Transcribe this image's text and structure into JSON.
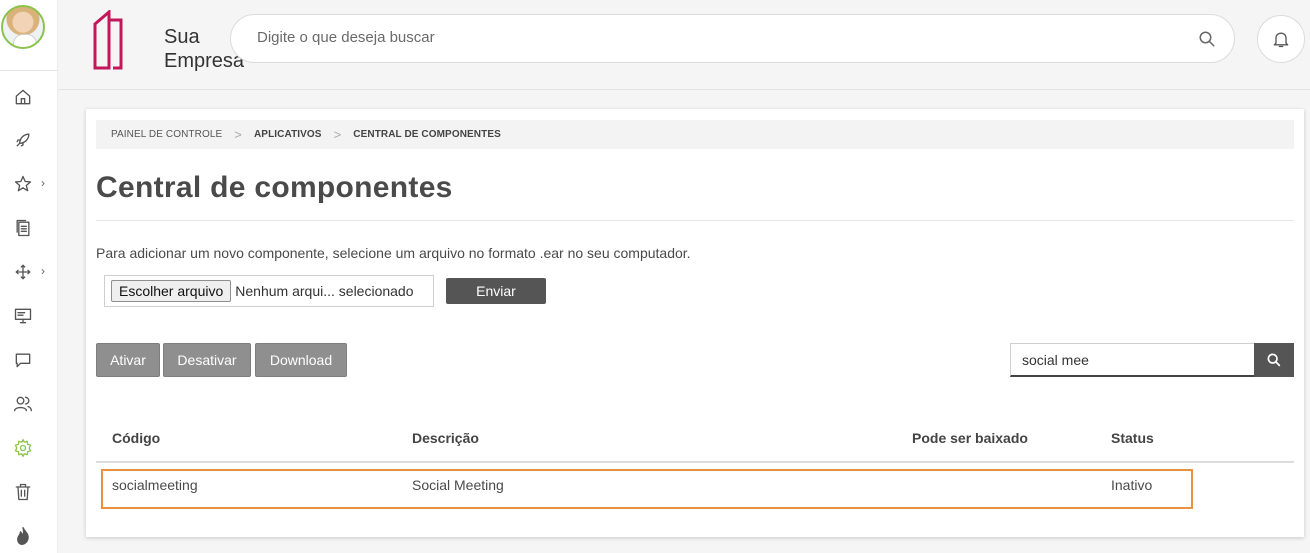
{
  "logo": {
    "line1": "Sua",
    "line2": "Empresa",
    "brand_color": "#c2185b"
  },
  "search": {
    "placeholder": "Digite o que deseja buscar"
  },
  "sidebar": {
    "icons": [
      "home-icon",
      "rocket-icon",
      "star-icon",
      "documents-icon",
      "arrows-icon",
      "monitor-icon",
      "chat-icon",
      "users-icon",
      "gear-icon",
      "trash-icon",
      "flame-icon"
    ],
    "active_icon": "gear-icon",
    "active_color": "#8bc34a"
  },
  "breadcrumb": {
    "items": [
      "PAINEL DE CONTROLE",
      "APLICATIVOS",
      "CENTRAL DE COMPONENTES"
    ]
  },
  "page": {
    "title": "Central de componentes",
    "instructions": "Para adicionar um novo componente, selecione um arquivo no formato .ear no seu computador."
  },
  "upload": {
    "choose_label": "Escolher arquivo",
    "no_file_label": "Nenhum arqui... selecionado",
    "submit_label": "Enviar"
  },
  "actions": {
    "activate": "Ativar",
    "deactivate": "Desativar",
    "download": "Download"
  },
  "filter": {
    "value": "social mee"
  },
  "table": {
    "headers": [
      "Código",
      "Descrição",
      "Pode ser baixado",
      "Status"
    ],
    "rows": [
      {
        "code": "socialmeeting",
        "description": "Social Meeting",
        "downloadable": "",
        "status": "Inativo"
      }
    ],
    "highlight_color": "#e8913f"
  }
}
